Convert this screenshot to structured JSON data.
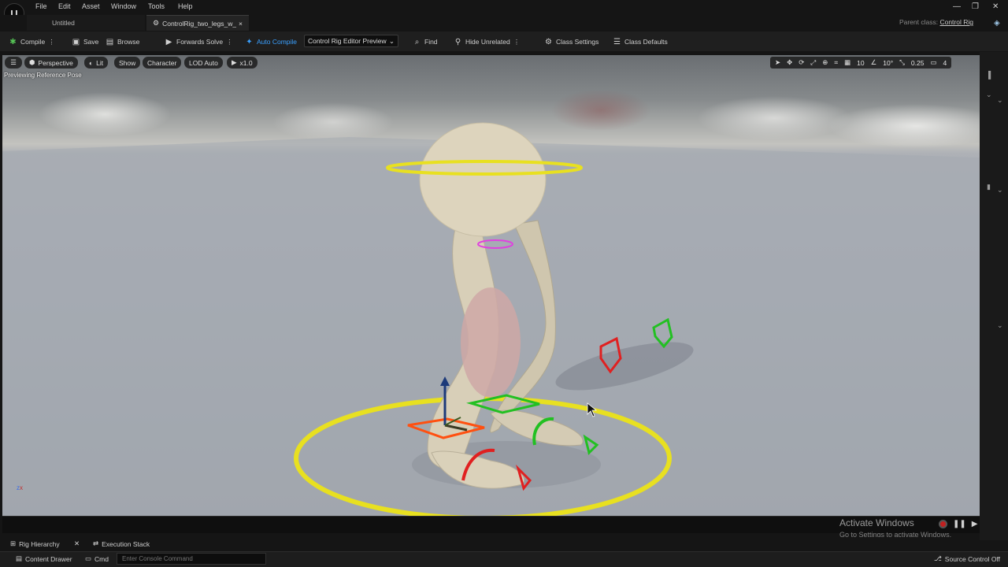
{
  "menu": {
    "items": [
      "File",
      "Edit",
      "Asset",
      "Window",
      "Tools",
      "Help"
    ]
  },
  "tabs": {
    "untitled": "Untitled",
    "rig": "ControlRig_two_legs_w_sc",
    "close_glyph": "×"
  },
  "parent_class": {
    "label": "Parent class:",
    "value": "Control Rig"
  },
  "toolbar": {
    "compile": "Compile",
    "save": "Save",
    "browse": "Browse",
    "forwards_solve": "Forwards Solve",
    "auto_compile": "Auto Compile",
    "preview_mode": "Control Rig Editor Preview",
    "find": "Find",
    "hide_unrelated": "Hide Unrelated",
    "class_settings": "Class Settings",
    "class_defaults": "Class Defaults"
  },
  "viewport": {
    "perspective": "Perspective",
    "lit": "Lit",
    "show": "Show",
    "character": "Character",
    "lod": "LOD Auto",
    "play_rate": "x1.0",
    "previewing": "Previewing Reference Pose",
    "grid_size": "10",
    "rotation_snap": "10°",
    "scale_snap": "0.25",
    "camera_speed": "4"
  },
  "watermark": {
    "title": "Activate Windows",
    "subtitle": "Go to Settings to activate Windows."
  },
  "panels": {
    "rig_hierarchy": "Rig Hierarchy",
    "execution_stack": "Execution Stack"
  },
  "status": {
    "content_drawer": "Content Drawer",
    "cmd": "Cmd",
    "console_placeholder": "Enter Console Command",
    "source_control": "Source Control Off"
  },
  "colors": {
    "accent_blue": "#3aa0ff",
    "control_yellow": "#e8e020",
    "control_red": "#e02020",
    "control_green": "#22c022",
    "control_magenta": "#e040e0",
    "control_orange": "#ff5010"
  }
}
